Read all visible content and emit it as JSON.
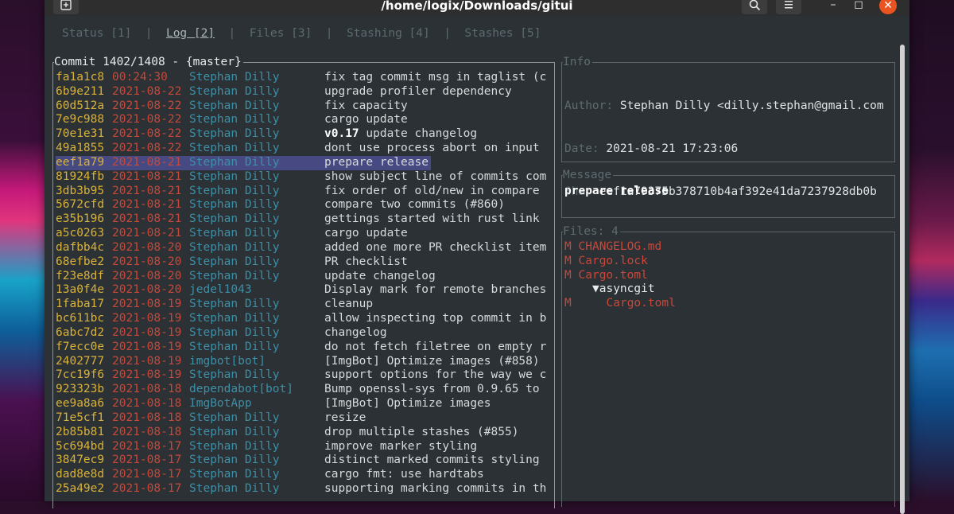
{
  "window": {
    "title": "/home/logix/Downloads/gitui"
  },
  "titlebar": {
    "new_tab_icon": "new-tab-icon",
    "search_icon": "search-icon",
    "menu_icon": "hamburger-menu-icon",
    "minimize_glyph": "–",
    "maximize_glyph": "◻",
    "close_glyph": "✕"
  },
  "tabs": [
    {
      "label": "Status [1]",
      "active": false
    },
    {
      "label": "Log [2]",
      "active": true
    },
    {
      "label": "Files [3]",
      "active": false
    },
    {
      "label": "Stashing [4]",
      "active": false
    },
    {
      "label": "Stashes [5]",
      "active": false
    }
  ],
  "tab_separator": "|",
  "log": {
    "title": "Commit 1402/1408 - {master}",
    "selected_index": 6,
    "commits": [
      {
        "hash": "fa1a1c8",
        "date": "00:24:30",
        "author": "Stephan Dilly",
        "msg": "fix tag commit msg in taglist (c"
      },
      {
        "hash": "6b9e211",
        "date": "2021-08-22",
        "author": "Stephan Dilly",
        "msg": "upgrade profiler dependency"
      },
      {
        "hash": "60d512a",
        "date": "2021-08-22",
        "author": "Stephan Dilly",
        "msg": "fix capacity"
      },
      {
        "hash": "7e9c988",
        "date": "2021-08-22",
        "author": "Stephan Dilly",
        "msg": "cargo update"
      },
      {
        "hash": "70e1e31",
        "date": "2021-08-22",
        "author": "Stephan Dilly",
        "tag": "v0.17",
        "msg": " update changelog"
      },
      {
        "hash": "49a1855",
        "date": "2021-08-22",
        "author": "Stephan Dilly",
        "msg": "dont use process abort on input"
      },
      {
        "hash": "eef1a79",
        "date": "2021-08-21",
        "author": "Stephan Dilly",
        "msg": "prepare release"
      },
      {
        "hash": "81924fb",
        "date": "2021-08-21",
        "author": "Stephan Dilly",
        "msg": "show subject line of commits com"
      },
      {
        "hash": "3db3b95",
        "date": "2021-08-21",
        "author": "Stephan Dilly",
        "msg": "fix order of old/new in compare"
      },
      {
        "hash": "5672cfd",
        "date": "2021-08-21",
        "author": "Stephan Dilly",
        "msg": "compare two commits (#860)"
      },
      {
        "hash": "e35b196",
        "date": "2021-08-21",
        "author": "Stephan Dilly",
        "msg": "gettings started with rust link"
      },
      {
        "hash": "a5c0263",
        "date": "2021-08-21",
        "author": "Stephan Dilly",
        "msg": "cargo update"
      },
      {
        "hash": "dafbb4c",
        "date": "2021-08-20",
        "author": "Stephan Dilly",
        "msg": "added one more PR checklist item"
      },
      {
        "hash": "68efbe2",
        "date": "2021-08-20",
        "author": "Stephan Dilly",
        "msg": "PR checklist"
      },
      {
        "hash": "f23e8df",
        "date": "2021-08-20",
        "author": "Stephan Dilly",
        "msg": "update changelog"
      },
      {
        "hash": "13a0f4e",
        "date": "2021-08-20",
        "author": "jedel1043",
        "msg": "Display mark for remote branches"
      },
      {
        "hash": "1faba17",
        "date": "2021-08-19",
        "author": "Stephan Dilly",
        "msg": "cleanup"
      },
      {
        "hash": "bc611bc",
        "date": "2021-08-19",
        "author": "Stephan Dilly",
        "msg": "allow inspecting top commit in b"
      },
      {
        "hash": "6abc7d2",
        "date": "2021-08-19",
        "author": "Stephan Dilly",
        "msg": "changelog"
      },
      {
        "hash": "f7ecc0e",
        "date": "2021-08-19",
        "author": "Stephan Dilly",
        "msg": "do not fetch filetree on empty r"
      },
      {
        "hash": "2402777",
        "date": "2021-08-19",
        "author": "imgbot[bot]",
        "msg": "[ImgBot] Optimize images (#858)"
      },
      {
        "hash": "7cc19f6",
        "date": "2021-08-19",
        "author": "Stephan Dilly",
        "msg": "support options for the way we c"
      },
      {
        "hash": "923323b",
        "date": "2021-08-18",
        "author": "dependabot[bot]",
        "msg": "Bump openssl-sys from 0.9.65 to"
      },
      {
        "hash": "ee9a8a6",
        "date": "2021-08-18",
        "author": "ImgBotApp",
        "msg": "[ImgBot] Optimize images"
      },
      {
        "hash": "71e5cf1",
        "date": "2021-08-18",
        "author": "Stephan Dilly",
        "msg": "resize"
      },
      {
        "hash": "2b85b81",
        "date": "2021-08-18",
        "author": "Stephan Dilly",
        "msg": "drop multiple stashes (#855)"
      },
      {
        "hash": "5c694bd",
        "date": "2021-08-17",
        "author": "Stephan Dilly",
        "msg": "improve marker styling"
      },
      {
        "hash": "3847ec9",
        "date": "2021-08-17",
        "author": "Stephan Dilly",
        "msg": "distinct marked commits styling"
      },
      {
        "hash": "dad8e8d",
        "date": "2021-08-17",
        "author": "Stephan Dilly",
        "msg": "cargo fmt: use hardtabs"
      },
      {
        "hash": "25a49e2",
        "date": "2021-08-17",
        "author": "Stephan Dilly",
        "msg": "supporting marking commits in th"
      }
    ]
  },
  "info": {
    "title": "Info",
    "author_label": "Author: ",
    "author_value": "Stephan Dilly <dilly.stephan@gmail.com",
    "date_label": "Date: ",
    "date_value": "2021-08-21 17:23:06",
    "sha_label": "Sha: ",
    "sha_value": "eef1a79375b378710b4af392e41da7237928db0b"
  },
  "message": {
    "title": "Message",
    "text": "prepare release"
  },
  "files": {
    "title": "Files: 4",
    "items": [
      {
        "status": "M",
        "name": "CHANGELOG.md",
        "indent": 1,
        "kind": "file"
      },
      {
        "status": "M",
        "name": "Cargo.lock",
        "indent": 1,
        "kind": "file"
      },
      {
        "status": "M",
        "name": "Cargo.toml",
        "indent": 1,
        "kind": "file"
      },
      {
        "status": "",
        "name": "▼asyncgit",
        "indent": 2,
        "kind": "dir"
      },
      {
        "status": "M",
        "name": "Cargo.toml",
        "indent": 3,
        "kind": "file"
      }
    ]
  },
  "colors": {
    "hash": "#d9b23a",
    "date": "#c8483a",
    "author": "#3e8fa6",
    "selection": "#474a82",
    "close_button": "#e95420"
  }
}
